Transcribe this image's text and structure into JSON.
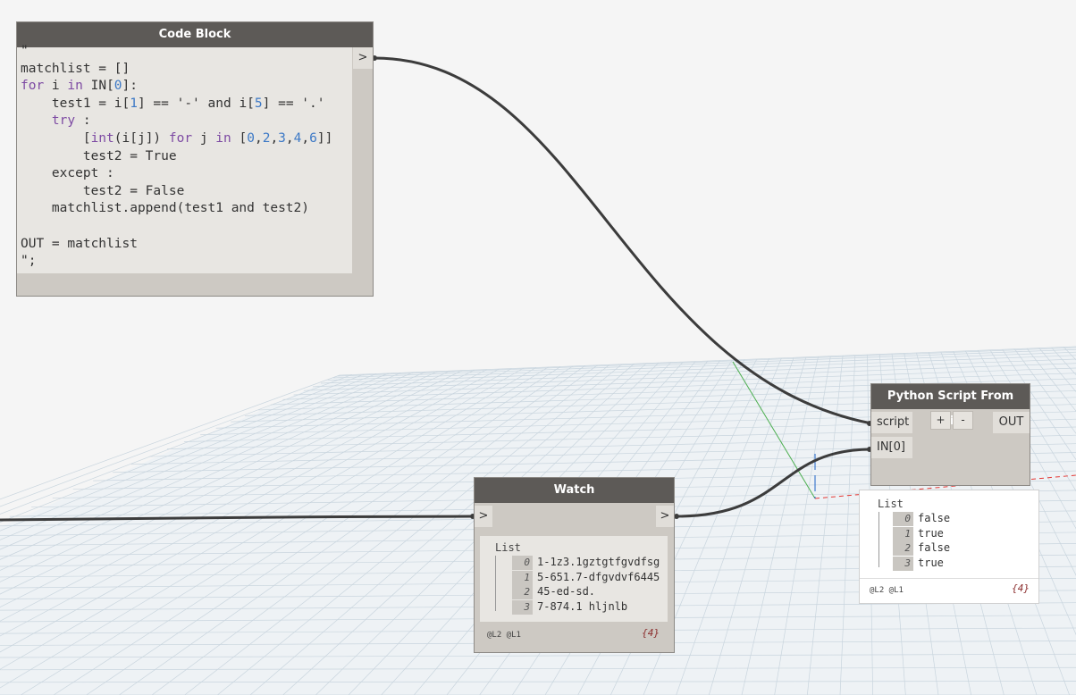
{
  "code_block": {
    "title": "Code Block",
    "out_port": ">",
    "lines": [
      [
        {
          "t": "\"",
          "c": ""
        }
      ],
      [
        {
          "t": "matchlist = []",
          "c": ""
        }
      ],
      [
        {
          "t": "for",
          "c": "kw"
        },
        {
          "t": " i ",
          "c": ""
        },
        {
          "t": "in",
          "c": "kw"
        },
        {
          "t": " IN[",
          "c": ""
        },
        {
          "t": "0",
          "c": "num"
        },
        {
          "t": "]:",
          "c": ""
        }
      ],
      [
        {
          "t": "    test1 = i[",
          "c": ""
        },
        {
          "t": "1",
          "c": "num"
        },
        {
          "t": "] == '-' and i[",
          "c": ""
        },
        {
          "t": "5",
          "c": "num"
        },
        {
          "t": "] == '.'",
          "c": ""
        }
      ],
      [
        {
          "t": "    ",
          "c": ""
        },
        {
          "t": "try",
          "c": "kw"
        },
        {
          "t": " :",
          "c": ""
        }
      ],
      [
        {
          "t": "        [",
          "c": ""
        },
        {
          "t": "int",
          "c": "kw"
        },
        {
          "t": "(i[j]) ",
          "c": ""
        },
        {
          "t": "for",
          "c": "kw"
        },
        {
          "t": " j ",
          "c": ""
        },
        {
          "t": "in",
          "c": "kw"
        },
        {
          "t": " [",
          "c": ""
        },
        {
          "t": "0",
          "c": "num"
        },
        {
          "t": ",",
          "c": ""
        },
        {
          "t": "2",
          "c": "num"
        },
        {
          "t": ",",
          "c": ""
        },
        {
          "t": "3",
          "c": "num"
        },
        {
          "t": ",",
          "c": ""
        },
        {
          "t": "4",
          "c": "num"
        },
        {
          "t": ",",
          "c": ""
        },
        {
          "t": "6",
          "c": "num"
        },
        {
          "t": "]]",
          "c": ""
        }
      ],
      [
        {
          "t": "        test2 = True",
          "c": ""
        }
      ],
      [
        {
          "t": "    except :",
          "c": ""
        }
      ],
      [
        {
          "t": "        test2 = False",
          "c": ""
        }
      ],
      [
        {
          "t": "    matchlist.append(test1 and test2)",
          "c": ""
        }
      ],
      [
        {
          "t": "",
          "c": ""
        }
      ],
      [
        {
          "t": "OUT = matchlist",
          "c": ""
        }
      ],
      [
        {
          "t": "\";",
          "c": ""
        }
      ]
    ]
  },
  "python_node": {
    "title": "Python Script From String",
    "inputs": [
      "script",
      "IN[0]"
    ],
    "output": "OUT",
    "add_label": "+",
    "remove_label": "-",
    "preview": {
      "title": "List",
      "items": [
        {
          "index": "0",
          "value": "false"
        },
        {
          "index": "1",
          "value": "true"
        },
        {
          "index": "2",
          "value": "false"
        },
        {
          "index": "3",
          "value": "true"
        }
      ],
      "levels": "@L2 @L1",
      "count": "{4}"
    }
  },
  "watch_node": {
    "title": "Watch",
    "in_port": ">",
    "out_port": ">",
    "preview": {
      "title": "List",
      "items": [
        {
          "index": "0",
          "value": "1-1z3.1gztgtfgvdfsg"
        },
        {
          "index": "1",
          "value": "5-651.7-dfgvdvf6445"
        },
        {
          "index": "2",
          "value": "45-ed-sd."
        },
        {
          "index": "3",
          "value": "7-874.1 hljnlb"
        }
      ],
      "levels": "@L2 @L1",
      "count": "{4}"
    }
  },
  "colors": {
    "header": "#5d5a57",
    "node_body": "#cdc9c3",
    "wire": "#3c3c3c",
    "keyword": "#7d4aa3",
    "number": "#3d79c6"
  }
}
